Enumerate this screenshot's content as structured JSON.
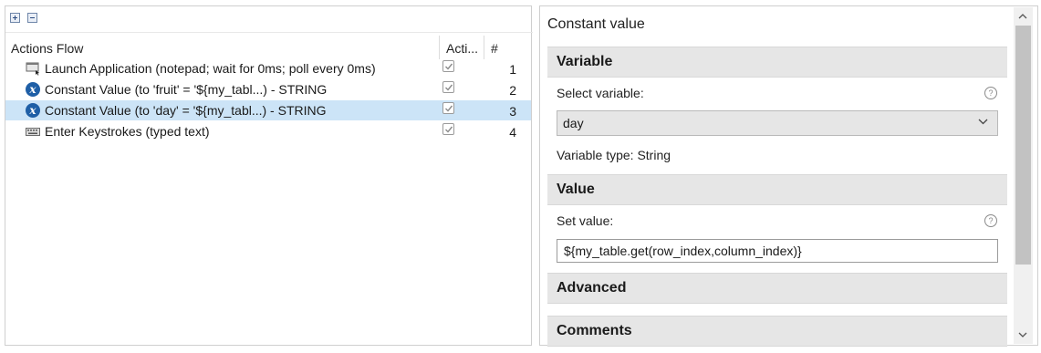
{
  "left_panel": {
    "toolbar": {
      "expand_icon": "expand-all-icon",
      "collapse_icon": "collapse-all-icon"
    },
    "columns": {
      "name": "Actions Flow",
      "active": "Acti...",
      "number": "#"
    },
    "rows": [
      {
        "icon": "application-window-icon",
        "label": "Launch Application (notepad; wait for 0ms; poll every 0ms)",
        "checked": true,
        "number": "1",
        "selected": false
      },
      {
        "icon": "variable-x-icon",
        "label": "Constant Value (to 'fruit' = '${my_tabl...) - STRING",
        "checked": true,
        "number": "2",
        "selected": false
      },
      {
        "icon": "variable-x-icon",
        "label": "Constant Value (to 'day' = '${my_tabl...) - STRING",
        "checked": true,
        "number": "3",
        "selected": true
      },
      {
        "icon": "keyboard-icon",
        "label": "Enter Keystrokes (typed text)",
        "checked": true,
        "number": "4",
        "selected": false
      }
    ]
  },
  "right_panel": {
    "title": "Constant value",
    "variable_section": {
      "header": "Variable",
      "select_label": "Select variable:",
      "selected_value": "day",
      "type_text": "Variable type: String"
    },
    "value_section": {
      "header": "Value",
      "set_label": "Set value:",
      "value": "${my_table.get(row_index,column_index)}"
    },
    "advanced_header": "Advanced",
    "comments_header": "Comments"
  },
  "colors": {
    "selection": "#cce4f7",
    "section_bg": "#e6e6e6",
    "icon_blue": "#1f5fa6"
  }
}
